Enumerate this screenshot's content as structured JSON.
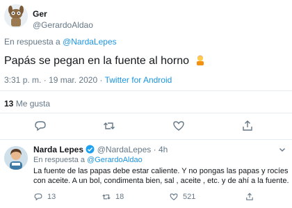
{
  "tweet": {
    "display_name": "Ger",
    "handle": "@GerardoAldao",
    "reply_prefix": "En respuesta a",
    "reply_to": "@NardaLepes",
    "text": "Papás se pegan en la fuente al horno",
    "time": "3:31 p. m.",
    "sep": "·",
    "date": "19 mar. 2020",
    "source": "Twitter for Android",
    "likes_count": "13",
    "likes_label": "Me gusta"
  },
  "reply": {
    "display_name": "Narda Lepes",
    "handle": "@NardaLepes",
    "sep": "·",
    "age": "4h",
    "reply_prefix": "En respuesta a",
    "reply_to": "@GerardoAldao",
    "text": "La fuente  de las papas debe estar caliente. Y no pongas las papas y rocíes con aceite. A un bol, condimenta bien, sal , aceite , etc. y de ahí a la fuente.",
    "replies": "13",
    "retweets": "18",
    "likes": "521"
  },
  "colors": {
    "link": "#1b95e0",
    "muted": "#657786",
    "text": "#14171a",
    "divider": "#e6ecf0"
  },
  "icons": [
    "reply-icon",
    "retweet-icon",
    "like-icon",
    "share-icon",
    "verified-icon",
    "chevron-down-icon",
    "emoji-person-icon"
  ]
}
